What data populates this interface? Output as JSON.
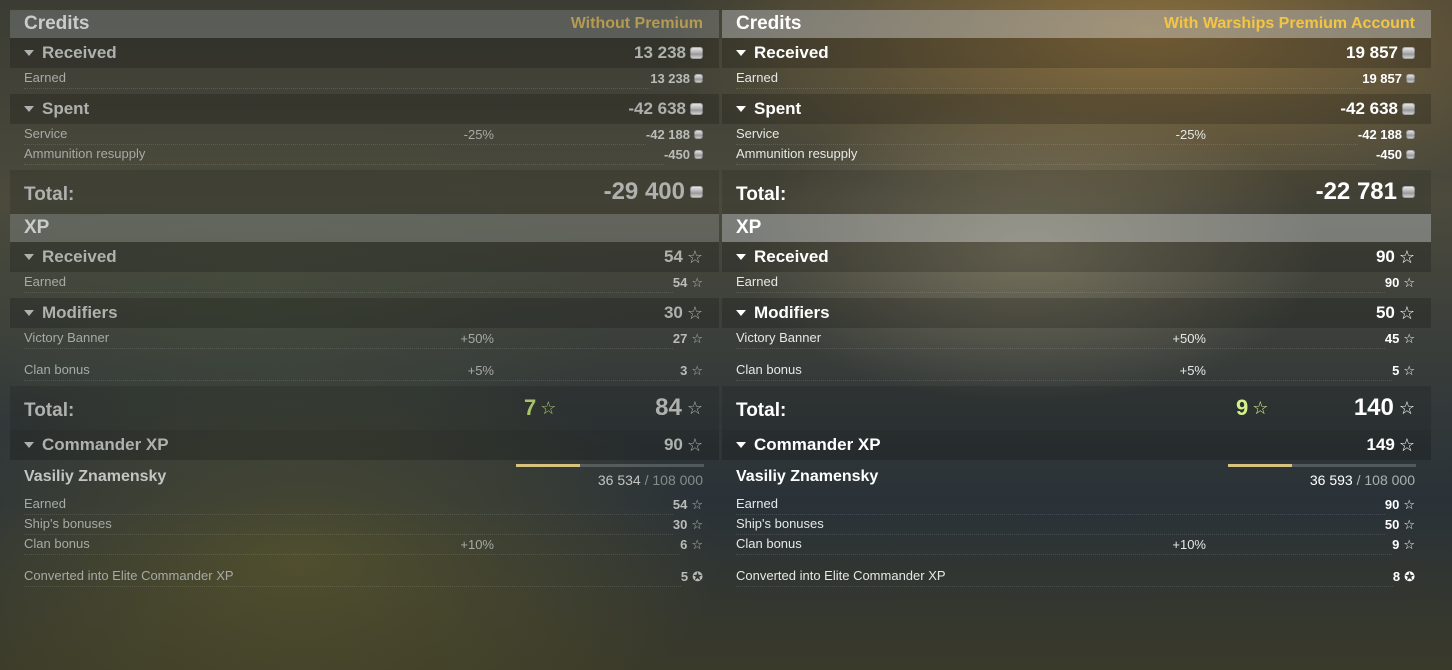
{
  "left": {
    "credits": {
      "title": "Credits",
      "account": "Without Premium",
      "received": {
        "label": "Received",
        "value": "13 238",
        "earned_label": "Earned",
        "earned_value": "13 238"
      },
      "spent": {
        "label": "Spent",
        "value": "-42 638",
        "service_label": "Service",
        "service_pct": "-25%",
        "service_value": "-42 188",
        "ammo_label": "Ammunition resupply",
        "ammo_value": "-450"
      },
      "total_label": "Total:",
      "total_value": "-29 400"
    },
    "xp": {
      "title": "XP",
      "received": {
        "label": "Received",
        "value": "54",
        "earned_label": "Earned",
        "earned_value": "54"
      },
      "modifiers": {
        "label": "Modifiers",
        "value": "30",
        "victory_label": "Victory Banner",
        "victory_pct": "+50%",
        "victory_value": "27",
        "clan_label": "Clan bonus",
        "clan_pct": "+5%",
        "clan_value": "3"
      },
      "total_label": "Total:",
      "total_bonus": "7",
      "total_value": "84"
    },
    "commander": {
      "label": "Commander XP",
      "value": "90",
      "name": "Vasiliy Znamensky",
      "xp_current": "36 534",
      "xp_max": "/ 108 000",
      "progress": 0.338,
      "earned_label": "Earned",
      "earned_value": "54",
      "ship_label": "Ship's bonuses",
      "ship_value": "30",
      "clan_label": "Clan bonus",
      "clan_pct": "+10%",
      "clan_value": "6",
      "elite_label": "Converted into Elite Commander XP",
      "elite_value": "5"
    }
  },
  "right": {
    "credits": {
      "title": "Credits",
      "account": "With Warships Premium Account",
      "received": {
        "label": "Received",
        "value": "19 857",
        "earned_label": "Earned",
        "earned_value": "19 857"
      },
      "spent": {
        "label": "Spent",
        "value": "-42 638",
        "service_label": "Service",
        "service_pct": "-25%",
        "service_value": "-42 188",
        "ammo_label": "Ammunition resupply",
        "ammo_value": "-450"
      },
      "total_label": "Total:",
      "total_value": "-22 781"
    },
    "xp": {
      "title": "XP",
      "received": {
        "label": "Received",
        "value": "90",
        "earned_label": "Earned",
        "earned_value": "90"
      },
      "modifiers": {
        "label": "Modifiers",
        "value": "50",
        "victory_label": "Victory Banner",
        "victory_pct": "+50%",
        "victory_value": "45",
        "clan_label": "Clan bonus",
        "clan_pct": "+5%",
        "clan_value": "5"
      },
      "total_label": "Total:",
      "total_bonus": "9",
      "total_value": "140"
    },
    "commander": {
      "label": "Commander XP",
      "value": "149",
      "name": "Vasiliy Znamensky",
      "xp_current": "36 593",
      "xp_max": "/ 108 000",
      "progress": 0.338,
      "earned_label": "Earned",
      "earned_value": "90",
      "ship_label": "Ship's bonuses",
      "ship_value": "50",
      "clan_label": "Clan bonus",
      "clan_pct": "+10%",
      "clan_value": "9",
      "elite_label": "Converted into Elite Commander XP",
      "elite_value": "8"
    }
  },
  "icons": {
    "credits": "credits-coin-icon",
    "xp": "xp-star-icon",
    "elite": "elite-commander-xp-icon"
  },
  "colors": {
    "premium_gold": "#f4c542",
    "bonus_green": "#d7f08a"
  }
}
